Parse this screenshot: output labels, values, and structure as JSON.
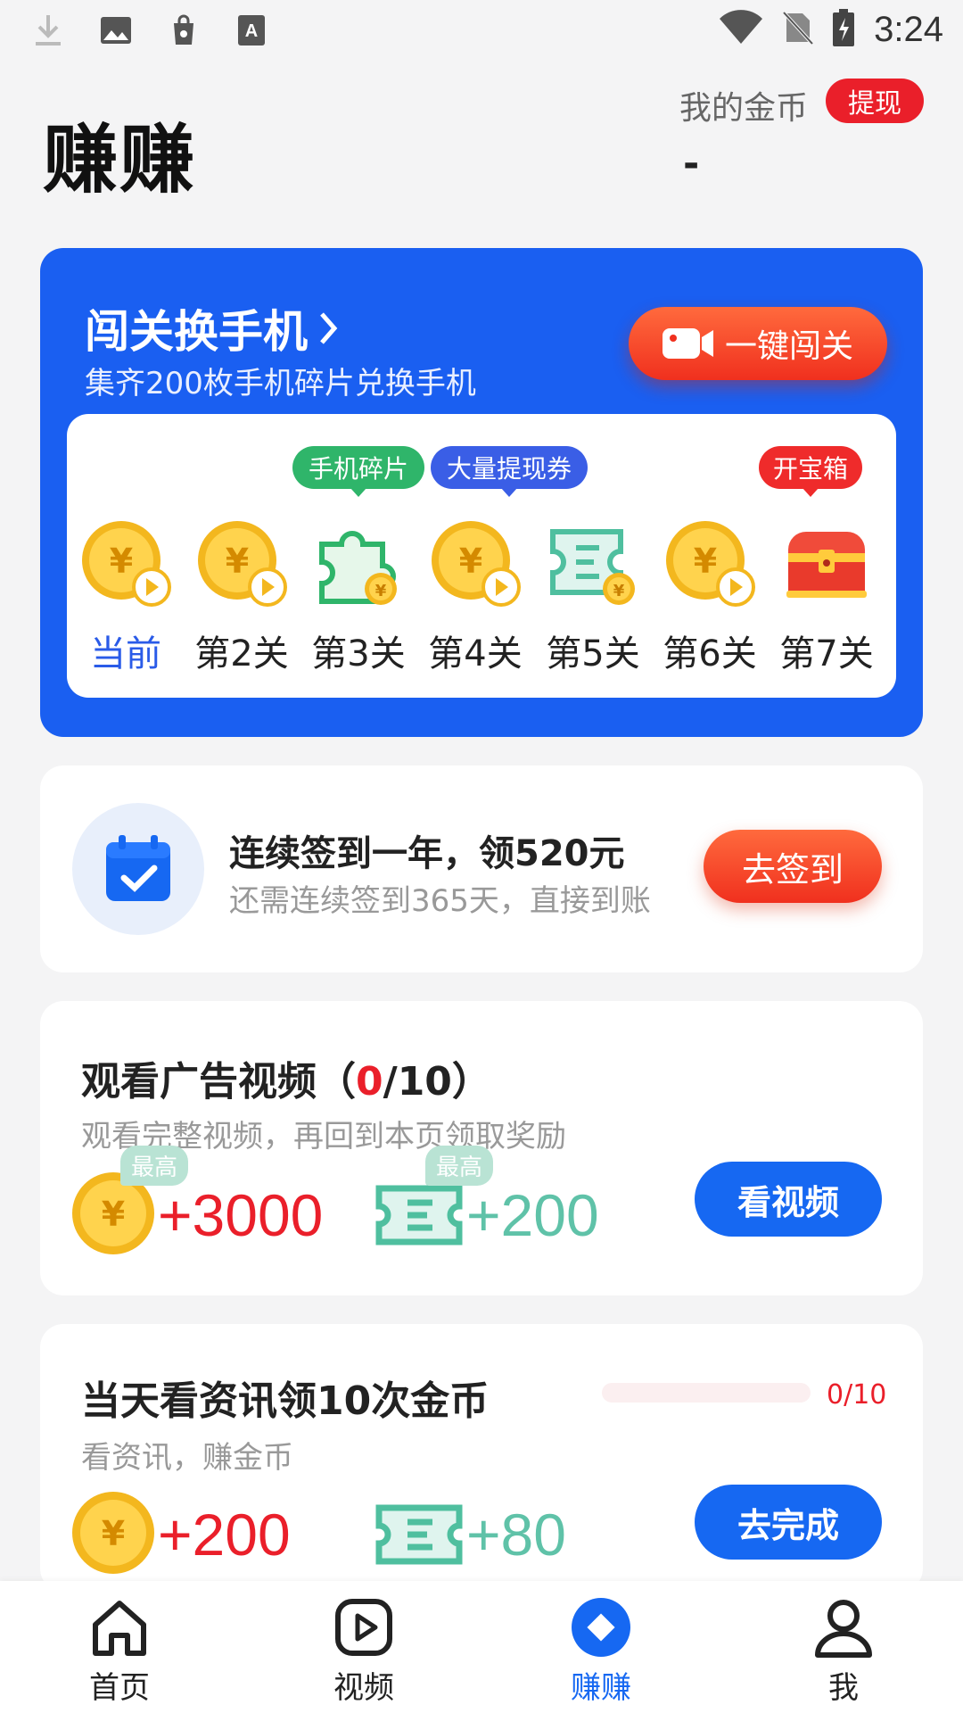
{
  "status_bar": {
    "time": "3:24",
    "left_icons": [
      "download-icon",
      "image-icon",
      "bag-icon",
      "keyboard-a-icon"
    ],
    "right_icons": [
      "wifi-icon",
      "no-sim-icon",
      "battery-charging-icon"
    ]
  },
  "header": {
    "title": "赚赚",
    "coins_label": "我的金币",
    "withdraw_label": "提现",
    "coins_value": "-"
  },
  "challenge_card": {
    "title": "闯关换手机",
    "subtitle": "集齐200枚手机碎片兑换手机",
    "button_label": "一键闯关",
    "levels": [
      {
        "label": "当前",
        "icon": "coin-play-icon",
        "tag": ""
      },
      {
        "label": "第2关",
        "icon": "coin-play-icon",
        "tag": ""
      },
      {
        "label": "第3关",
        "icon": "puzzle-piece-icon",
        "tag": "手机碎片"
      },
      {
        "label": "第4关",
        "icon": "coin-play-icon",
        "tag": ""
      },
      {
        "label": "第5关",
        "icon": "ticket-icon",
        "tag": "大量提现券"
      },
      {
        "label": "第6关",
        "icon": "coin-play-icon",
        "tag": ""
      },
      {
        "label": "第7关",
        "icon": "treasure-chest-icon",
        "tag": "开宝箱"
      }
    ]
  },
  "signin_card": {
    "title": "连续签到一年，领520元",
    "subtitle": "还需连续签到365天，直接到账",
    "button_label": "去签到"
  },
  "ad_card": {
    "title_prefix": "观看广告视频（",
    "title_count": "0",
    "title_suffix": "/10）",
    "subtitle": "观看完整视频，再回到本页领取奖励",
    "coin_tag": "最高",
    "coin_reward": "+3000",
    "ticket_tag": "最高",
    "ticket_reward": "+200",
    "button_label": "看视频"
  },
  "news_card": {
    "title": "当天看资讯领10次金币",
    "subtitle": "看资讯，赚金币",
    "progress_text": "0/10",
    "progress_fraction": 0,
    "coin_reward": "+200",
    "ticket_reward": "+80",
    "button_label": "去完成"
  },
  "bottom_nav": {
    "items": [
      {
        "label": "首页",
        "icon": "home-icon",
        "active": false
      },
      {
        "label": "视频",
        "icon": "video-play-icon",
        "active": false
      },
      {
        "label": "赚赚",
        "icon": "earn-diamond-icon",
        "active": true
      },
      {
        "label": "我",
        "icon": "profile-icon",
        "active": false
      }
    ]
  },
  "colors": {
    "brand_blue": "#1a5ff1",
    "accent_red": "#ea1f2a",
    "teal": "#5fc2a8",
    "coin_gold": "#f5c233"
  }
}
